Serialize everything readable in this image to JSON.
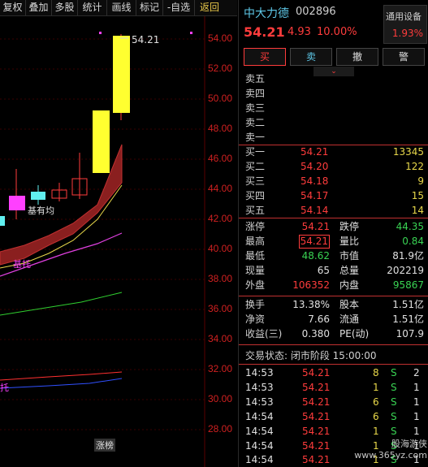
{
  "toolbar": {
    "items": [
      "复权",
      "叠加",
      "多股",
      "统计",
      "画线",
      "标记",
      "-自选",
      "返回"
    ]
  },
  "chart": {
    "y_ticks": [
      "54.00",
      "52.00",
      "50.00",
      "48.00",
      "46.00",
      "44.00",
      "42.00",
      "40.00",
      "38.00",
      "36.00",
      "34.00",
      "32.00",
      "30.00",
      "28.00"
    ],
    "high_label": "54.21",
    "annotation_bottom": "涨榜",
    "annotation_left1": "基有均",
    "annotation_left2": "基托",
    "annotation_left3": "托"
  },
  "header": {
    "name": "中大力德",
    "code": "002896",
    "price": "54.21",
    "change": "4.93",
    "change_pct": "10.00%",
    "industry": "通用设备",
    "industry_pct": "1.93%"
  },
  "actions": [
    "买",
    "卖",
    "撤",
    "警"
  ],
  "ask": [
    {
      "label": "卖五",
      "price": "",
      "vol": ""
    },
    {
      "label": "卖四",
      "price": "",
      "vol": ""
    },
    {
      "label": "卖三",
      "price": "",
      "vol": ""
    },
    {
      "label": "卖二",
      "price": "",
      "vol": ""
    },
    {
      "label": "卖一",
      "price": "",
      "vol": ""
    }
  ],
  "bid": [
    {
      "label": "买一",
      "price": "54.21",
      "vol": "13345"
    },
    {
      "label": "买二",
      "price": "54.20",
      "vol": "122"
    },
    {
      "label": "买三",
      "price": "54.18",
      "vol": "9"
    },
    {
      "label": "买四",
      "price": "54.17",
      "vol": "15"
    },
    {
      "label": "买五",
      "price": "54.14",
      "vol": "14"
    }
  ],
  "stats1": [
    {
      "l1": "涨停",
      "v1": "54.21",
      "l2": "跌停",
      "v2": "44.35"
    },
    {
      "l1": "最高",
      "v1": "54.21",
      "l2": "量比",
      "v2": "0.84"
    },
    {
      "l1": "最低",
      "v1": "48.62",
      "l2": "市值",
      "v2": "81.9亿"
    },
    {
      "l1": "现量",
      "v1": "65",
      "l2": "总量",
      "v2": "202219"
    },
    {
      "l1": "外盘",
      "v1": "106352",
      "l2": "内盘",
      "v2": "95867"
    }
  ],
  "stats2": [
    {
      "l1": "换手",
      "v1": "13.38%",
      "l2": "股本",
      "v2": "1.51亿"
    },
    {
      "l1": "净资",
      "v1": "7.66",
      "l2": "流通",
      "v2": "1.51亿"
    },
    {
      "l1": "收益(三)",
      "v1": "0.380",
      "l2": "PE(动)",
      "v2": "107.9"
    }
  ],
  "trade_status": "交易状态: 闭市阶段 15:00:00",
  "ticks": [
    {
      "time": "14:53",
      "price": "54.21",
      "vol": "8",
      "side": "S",
      "n": "2"
    },
    {
      "time": "14:53",
      "price": "54.21",
      "vol": "1",
      "side": "S",
      "n": "1"
    },
    {
      "time": "14:53",
      "price": "54.21",
      "vol": "6",
      "side": "S",
      "n": "1"
    },
    {
      "time": "14:54",
      "price": "54.21",
      "vol": "6",
      "side": "S",
      "n": "1"
    },
    {
      "time": "14:54",
      "price": "54.21",
      "vol": "1",
      "side": "S",
      "n": "1"
    },
    {
      "time": "14:54",
      "price": "54.21",
      "vol": "1",
      "side": "S",
      "n": "1"
    },
    {
      "time": "14:54",
      "price": "54.21",
      "vol": "1",
      "side": "S",
      "n": "1"
    }
  ],
  "watermark": "股海游侠 www.365yz.com"
}
